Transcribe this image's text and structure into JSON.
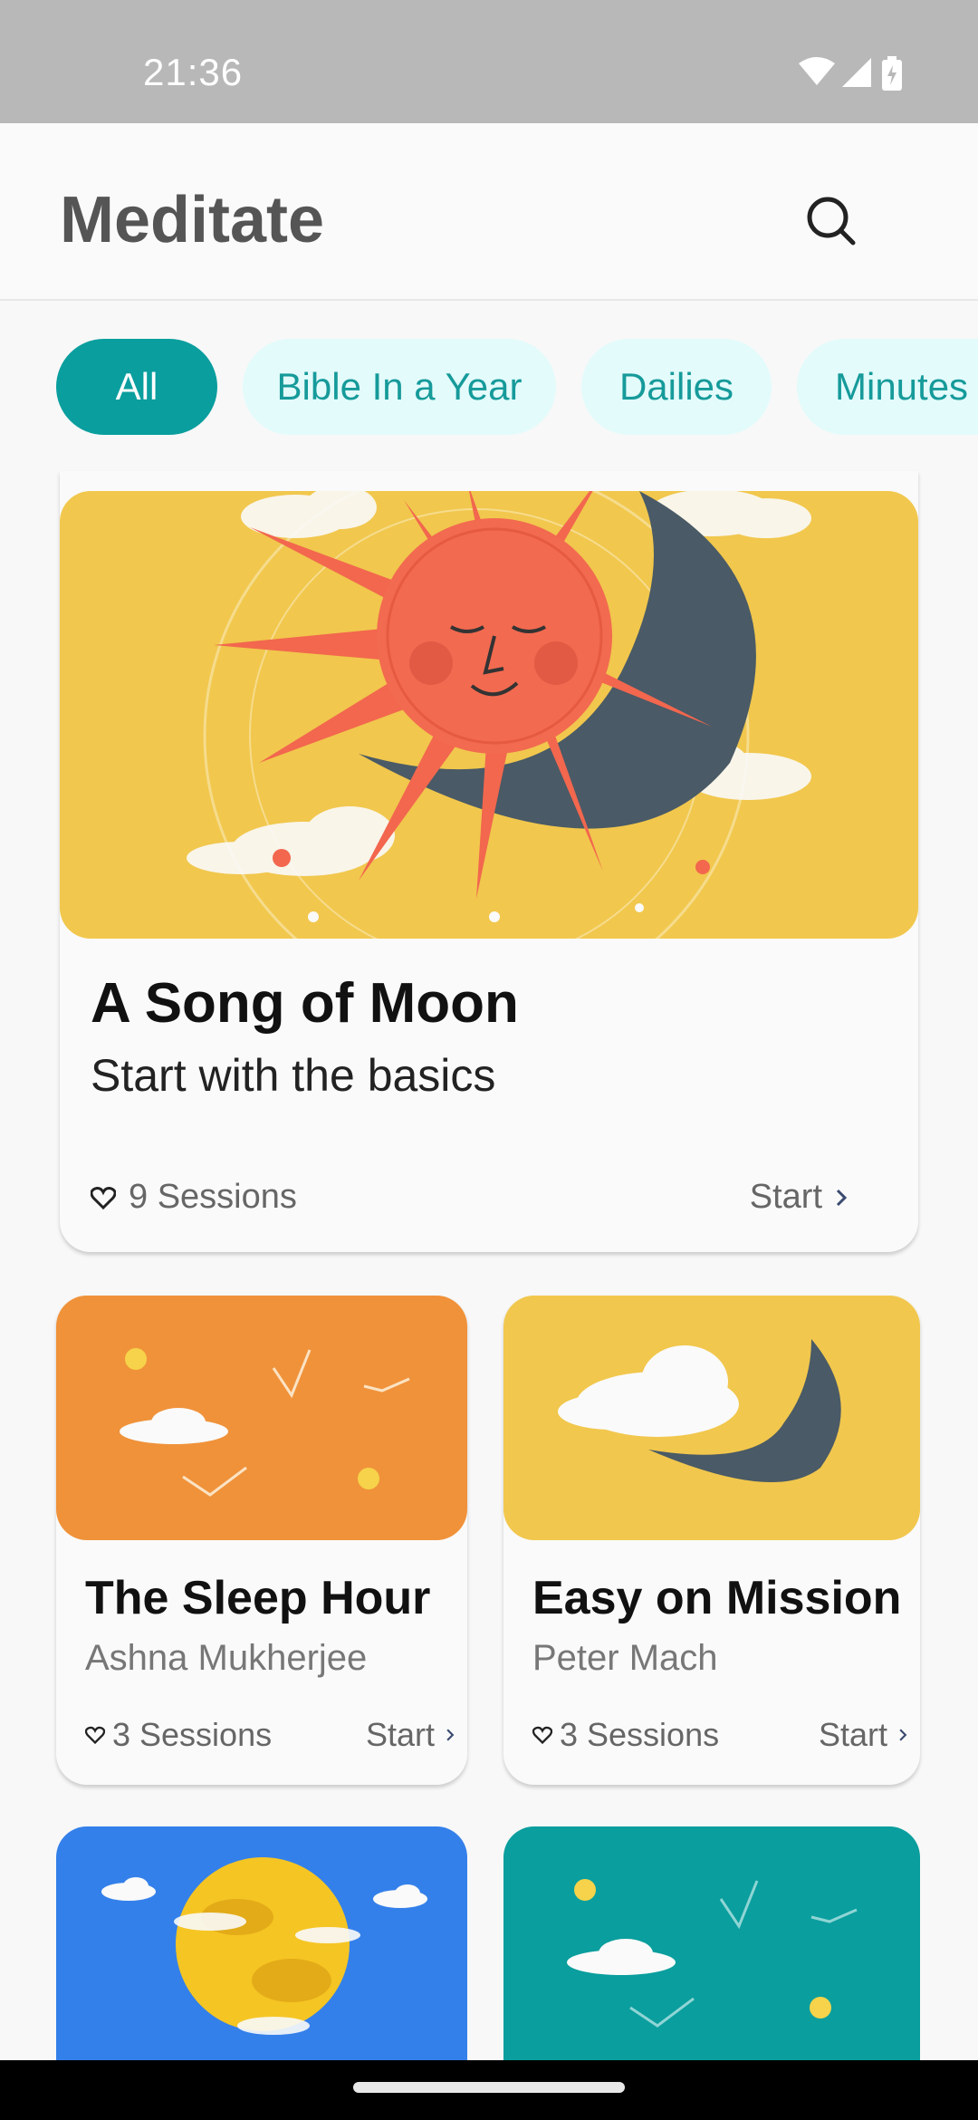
{
  "status_bar": {
    "time": "21:36"
  },
  "app_bar": {
    "title": "Meditate"
  },
  "chips": [
    {
      "label": "All",
      "active": true
    },
    {
      "label": "Bible In a Year",
      "active": false
    },
    {
      "label": "Dailies",
      "active": false
    },
    {
      "label": "Minutes",
      "active": false
    }
  ],
  "featured": {
    "title": "A Song of Moon",
    "subtitle": "Start with the basics",
    "sessions": "9 Sessions",
    "start": "Start"
  },
  "cards": [
    {
      "title": "The Sleep Hour",
      "author": "Ashna Mukherjee",
      "sessions": "3 Sessions",
      "start": "Start"
    },
    {
      "title": "Easy on Mission",
      "author": "Peter Mach",
      "sessions": "3 Sessions",
      "start": "Start"
    }
  ],
  "colors": {
    "accent": "#0a9e9e",
    "chip_bg": "#e3fbfb",
    "featured_bg": "#f1c74d",
    "card_orange": "#f0923a",
    "card_yellow": "#f1c74d",
    "card_blue": "#3480ea",
    "card_teal": "#0a9e9e"
  }
}
